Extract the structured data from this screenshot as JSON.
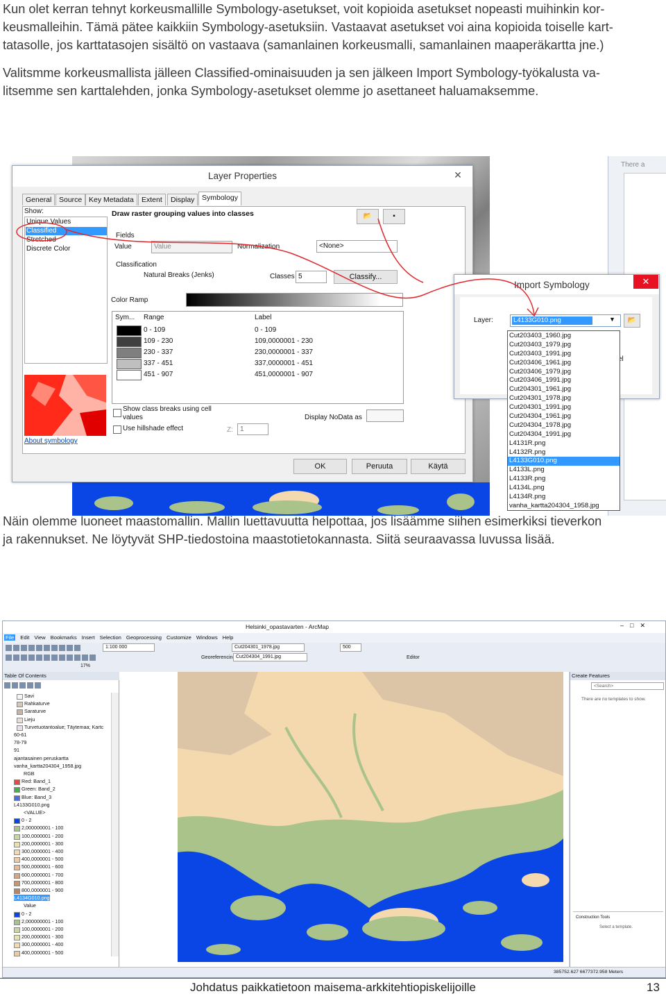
{
  "paragraphs": {
    "p1_line1": "Kun olet kerran tehnyt korkeusmallille Symbology-asetukset, voit kopioida asetukset nopeasti muihinkin kor-",
    "p1_line2": "keusmalleihin. Tämä pätee kaikkiin Symbology-asetuksiin. Vastaavat asetukset voi aina kopioida toiselle kart-",
    "p1_line3": "tatasolle, jos karttatasojen sisältö on vastaava (samanlainen korkeusmalli, samanlainen maaperäkartta jne.)",
    "p2_line1": "Valitsmme korkeusmallista jälleen Classified-ominaisuuden ja sen jälkeen Import Symbology-työkalusta va-",
    "p2_line2": "litsemme sen karttalehden, jonka Symbology-asetukset olemme jo asettaneet haluamaksemme.",
    "p3_line1": "Näin olemme luoneet maastomallin. Mallin luettavuutta helpottaa, jos lisäämme siihen esimerkiksi tieverkon",
    "p3_line2": "ja rakennukset. Ne löytyvät SHP-tiedostoina maastotietokannasta. Siitä seuraavassa luvussa lisää."
  },
  "layer_properties": {
    "title": "Layer Properties",
    "tabs": [
      "General",
      "Source",
      "Key Metadata",
      "Extent",
      "Display",
      "Symbology"
    ],
    "show_label": "Show:",
    "show_items": [
      "Unique Values",
      "Classified",
      "Stretched",
      "Discrete Color"
    ],
    "heading": "Draw raster grouping values into classes",
    "fields_label": "Fields",
    "value_label": "Value",
    "value_field": "Value",
    "normalization_label": "Normalization",
    "normalization_value": "<None>",
    "classification_label": "Classification",
    "method": "Natural Breaks (Jenks)",
    "classes_label": "Classes",
    "classes_value": "5",
    "classify_button": "Classify...",
    "color_ramp_label": "Color Ramp",
    "table_headers": {
      "sym": "Sym...",
      "range": "Range",
      "label": "Label"
    },
    "rows": [
      {
        "range": "0 - 109",
        "label": "0 - 109",
        "color": "#000000"
      },
      {
        "range": "109 - 230",
        "label": "109,0000001 - 230",
        "color": "#3f3f3f"
      },
      {
        "range": "230 - 337",
        "label": "230,0000001 - 337",
        "color": "#7f7f7f"
      },
      {
        "range": "337 - 451",
        "label": "337,0000001 - 451",
        "color": "#bfbfbf"
      },
      {
        "range": "451 - 907",
        "label": "451,0000001 - 907",
        "color": "#ffffff"
      }
    ],
    "show_breaks_line1": "Show class breaks using cell",
    "show_breaks_line2": "values",
    "hillshade": "Use hillshade effect",
    "z_label": "Z:",
    "z_value": "1",
    "nodata_label": "Display NoData as",
    "about": "About symbology",
    "ok": "OK",
    "cancel": "Peruuta",
    "apply": "Käytä"
  },
  "import_symbology": {
    "title": "Import Symbology",
    "layer_label": "Layer:",
    "layer_value": "L4133G010.png",
    "options": [
      "Cut203403_1960.jpg",
      "Cut203403_1979.jpg",
      "Cut203403_1991.jpg",
      "Cut203406_1961.jpg",
      "Cut203406_1979.jpg",
      "Cut203406_1991.jpg",
      "Cut204301_1961.jpg",
      "Cut204301_1978.jpg",
      "Cut204301_1991.jpg",
      "Cut204304_1961.jpg",
      "Cut204304_1978.jpg",
      "Cut204304_1991.jpg",
      "L4131R.png",
      "L4132R.png",
      "L4133G010.png",
      "L4133L.png",
      "L4133R.png",
      "L4134L.png",
      "L4134R.png",
      "vanha_kartta204304_1958.jpg"
    ],
    "selected_index": 14,
    "side_text": "There a",
    "side_el": "el"
  },
  "arcmap": {
    "title": "Helsinki_opastavarten - ArcMap",
    "menu": [
      "File",
      "Edit",
      "View",
      "Bookmarks",
      "Insert",
      "Selection",
      "Geoprocessing",
      "Customize",
      "Windows",
      "Help"
    ],
    "scale": "1:100 000",
    "layer_combo": "Cut204301_1978.jpg",
    "zoom_value": "500",
    "georef_label": "Georeferencing",
    "georef_combo": "Cut204304_1991.jpg",
    "editor_label": "Editor",
    "percent": "17%",
    "toc_title": "Table Of Contents",
    "toc_items": [
      "Savi",
      "Rahkaturve",
      "Saraturve",
      "Lieju",
      "Turvetuotantoalue; Täytemaa; Kartc",
      "60-61",
      "78-79",
      "91",
      "ajantasainen peruskartta",
      "vanha_kartta204304_1958.jpg",
      "RGB",
      "Red:   Band_1",
      "Green: Band_2",
      "Blue:   Band_3",
      "L4133G010.png",
      "<VALUE>",
      "0 - 2",
      "2,000000001 - 100",
      "100,0000001 - 200",
      "200,0000001 - 300",
      "300,0000001 - 400",
      "400,0000001 - 500",
      "500,0000001 - 600",
      "600,0000001 - 700",
      "700,0000001 - 800",
      "800,0000001 - 900",
      "L4134G010.png",
      "Value",
      "0 - 2",
      "2,000000001 - 100",
      "100,0000001 - 200",
      "200,0000001 - 300",
      "300,0000001 - 400",
      "400,0000001 - 500"
    ],
    "create_features_title": "Create Features",
    "search_placeholder": "<Search>",
    "no_templates": "There are no templates to show.",
    "construction_tools": "Construction Tools",
    "select_template": "Select a template.",
    "coords": "385752.627  6677372.958 Meters"
  },
  "footer": {
    "title": "Johdatus paikkatietoon maisema-arkkitehtiopiskelijoille",
    "page": "13"
  },
  "colors": {
    "water": "#0a46e6",
    "lowland": "#a9c38a",
    "upland": "#f3d9ad",
    "high": "#dcc5a7",
    "annotation": "#e0282d",
    "selection": "#3399ff"
  }
}
